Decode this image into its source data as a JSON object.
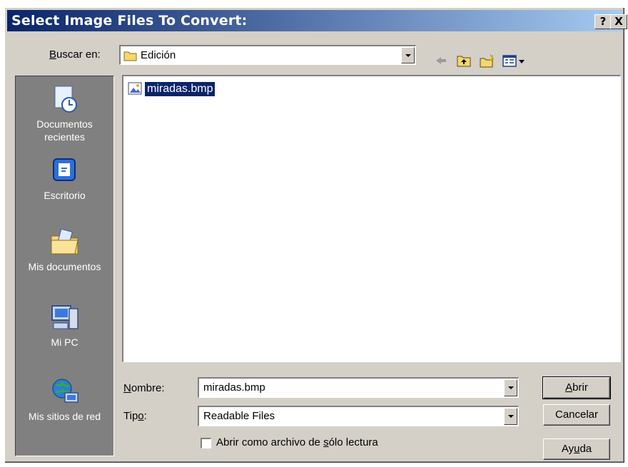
{
  "window": {
    "title": "Select Image Files To Convert:",
    "help_btn": "?",
    "close_btn": "X"
  },
  "lookin": {
    "label_pre": "",
    "label_ul": "B",
    "label_post": "uscar en:",
    "value": "Edición"
  },
  "places": [
    {
      "line1": "Documentos",
      "line2": "recientes",
      "icon": "recent-documents-icon"
    },
    {
      "line1": "Escritorio",
      "line2": "",
      "icon": "desktop-icon"
    },
    {
      "line1": "Mis documentos",
      "line2": "",
      "icon": "my-documents-icon"
    },
    {
      "line1": "Mi PC",
      "line2": "",
      "icon": "my-computer-icon"
    },
    {
      "line1": "Mis sitios de red",
      "line2": "",
      "icon": "network-places-icon"
    }
  ],
  "files": [
    {
      "name": "miradas.bmp",
      "icon": "bitmap-file-icon",
      "selected": true
    }
  ],
  "filename": {
    "label_ul": "N",
    "label_post": "ombre:",
    "value": "miradas.bmp"
  },
  "filetype": {
    "label_pre": "Tip",
    "label_ul": "o",
    "label_post": ":",
    "value": "Readable Files"
  },
  "readonly": {
    "label_pre": "Abrir como archivo de ",
    "label_ul": "s",
    "label_post": "ólo lectura",
    "checked": false
  },
  "buttons": {
    "open": {
      "pre": "",
      "ul": "A",
      "post": "brir"
    },
    "cancel": {
      "pre": "Cancelar",
      "ul": "",
      "post": ""
    },
    "help": {
      "pre": "Ay",
      "ul": "u",
      "post": "da"
    }
  },
  "colors": {
    "title_start": "#0a246a",
    "title_end": "#a6caf0",
    "selection": "#0a246a",
    "face": "#d4d0c8",
    "places_bg": "#808080"
  }
}
